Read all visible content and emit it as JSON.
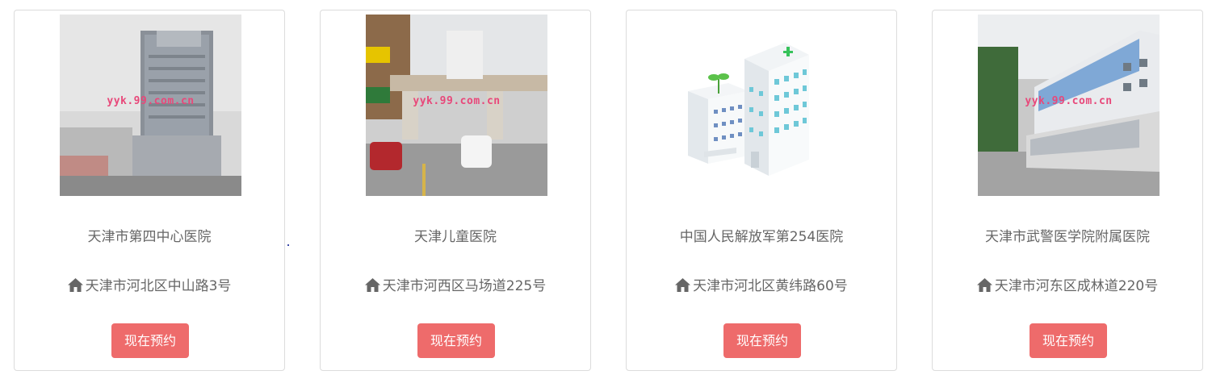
{
  "hospitals": [
    {
      "name": "天津市第四中心医院",
      "address": "天津市河北区中山路3号",
      "watermark": "yyk.99.com.cn",
      "button": "现在预约",
      "image": "photo-tower-building"
    },
    {
      "name": "天津儿童医院",
      "address": "天津市河西区马场道225号",
      "watermark": "yyk.99.com.cn",
      "button": "现在预约",
      "image": "photo-gate-street"
    },
    {
      "name": "中国人民解放军第254医院",
      "address": "天津市河北区黄纬路60号",
      "watermark": "",
      "button": "现在预约",
      "image": "hospital-illustration"
    },
    {
      "name": "天津市武警医学院附属医院",
      "address": "天津市河东区成林道220号",
      "watermark": "yyk.99.com.cn",
      "button": "现在预约",
      "image": "photo-campus-sign"
    }
  ],
  "icons": {
    "address": "home-icon"
  },
  "colors": {
    "button": "#ee6b6b",
    "border": "#dcdcdc",
    "text": "#666666",
    "watermark": "#e8487a"
  }
}
